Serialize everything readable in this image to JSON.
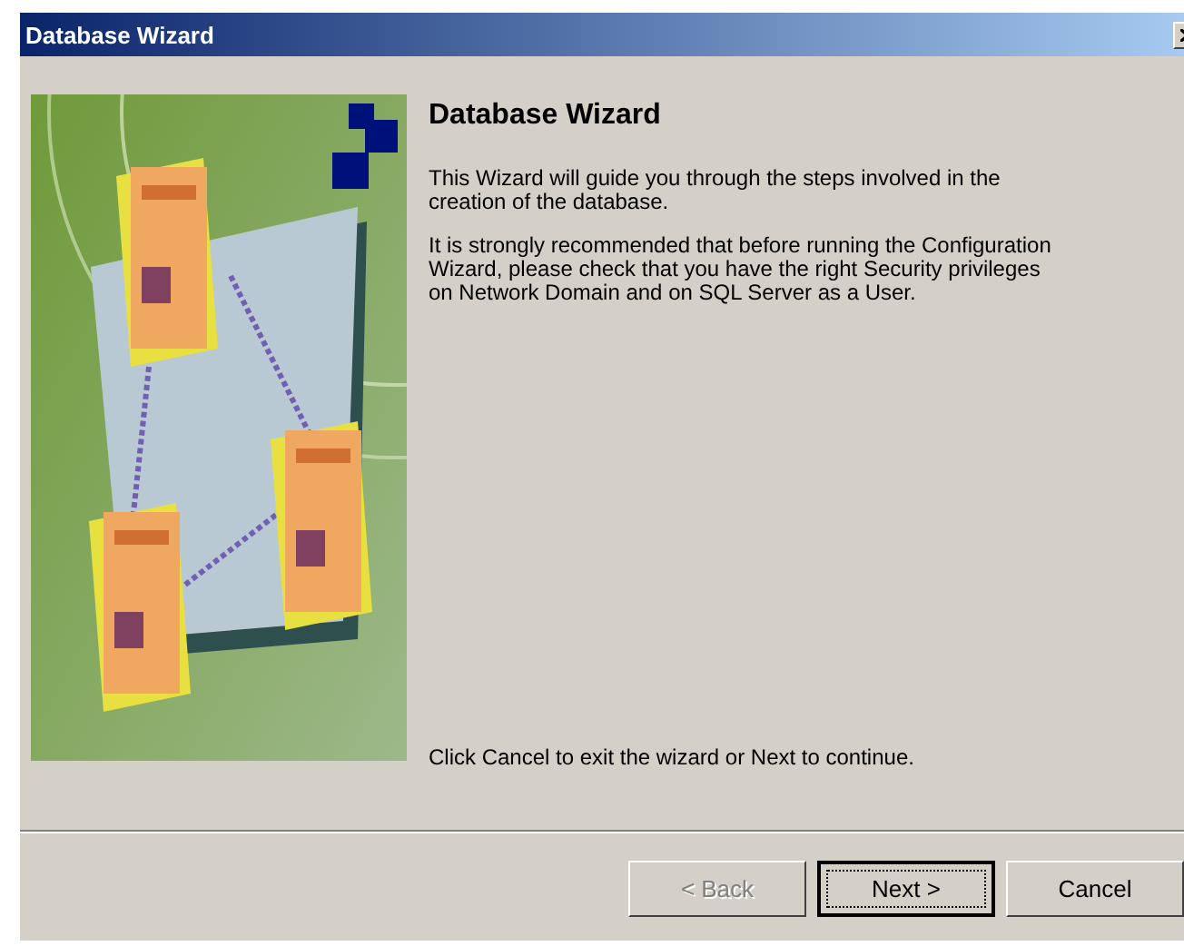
{
  "window": {
    "title": "Database Wizard"
  },
  "heading": "Database Wizard",
  "paragraphs": [
    "This Wizard will guide you through the steps involved in the creation of the database.",
    "It is strongly recommended that before running the Configuration Wizard, please check that you have the right Security privileges on Network Domain and on SQL Server as a User."
  ],
  "footer_text": "Click Cancel to exit the wizard or Next to continue.",
  "buttons": [
    {
      "label": "< Back",
      "disabled": true,
      "default": false
    },
    {
      "label": "Next >",
      "disabled": false,
      "default": true
    },
    {
      "label": "Cancel",
      "disabled": false,
      "default": false
    }
  ]
}
